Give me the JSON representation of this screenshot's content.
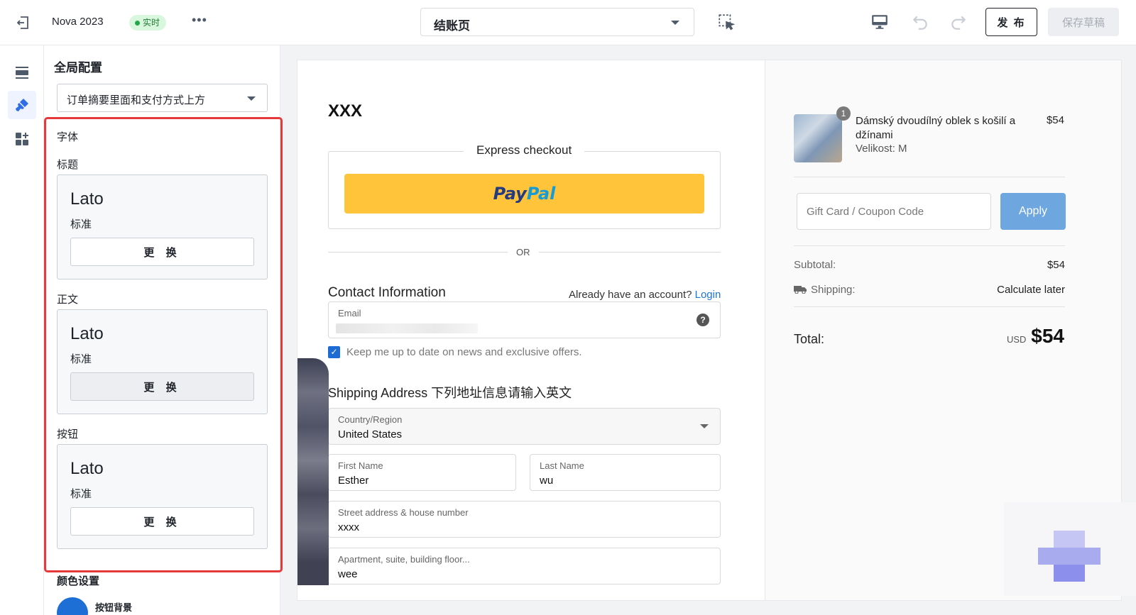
{
  "topbar": {
    "store_name": "Nova 2023",
    "live_badge": "实时",
    "more_label": "•••",
    "page_selected": "结账页",
    "publish_label": "发 布",
    "save_draft_label": "保存草稿"
  },
  "rail": {
    "items": [
      "sections-icon",
      "paint-brush-icon",
      "add-widget-icon"
    ]
  },
  "panel": {
    "title": "全局配置",
    "layout_option": "订单摘要里面和支付方式上方",
    "font_section_label": "字体",
    "fonts": [
      {
        "label": "标题",
        "family": "Lato",
        "style": "标准",
        "button": "更 换"
      },
      {
        "label": "正文",
        "family": "Lato",
        "style": "标准",
        "button": "更 换"
      },
      {
        "label": "按钮",
        "family": "Lato",
        "style": "标准",
        "button": "更 换"
      }
    ],
    "color_title": "颜色设置",
    "color_item_label": "按钮背景",
    "highlight_color": "#e5393c",
    "button_bg_color": "#1d6fd6"
  },
  "checkout": {
    "store_logo_text": "XXX",
    "express_title": "Express checkout",
    "paypal_part1": "Pay",
    "paypal_part2": "Pal",
    "or_text": "OR",
    "contact_title": "Contact Information",
    "account_question": "Already have an account?",
    "login_link": "Login",
    "email_label": "Email",
    "newsletter_label": "Keep me up to date on news and exclusive offers.",
    "shipping_title": "Shipping Address 下列地址信息请输入英文",
    "fields": {
      "country": {
        "label": "Country/Region",
        "value": "United States"
      },
      "first_name": {
        "label": "First Name",
        "value": "Esther"
      },
      "last_name": {
        "label": "Last Name",
        "value": "wu"
      },
      "street": {
        "label": "Street address & house number",
        "value": "xxxx"
      },
      "apartment": {
        "label": "Apartment, suite, building floor...",
        "value": "wee"
      }
    }
  },
  "summary": {
    "item": {
      "quantity": "1",
      "name": "Dámský dvoudílný oblek s košilí a džínami",
      "variant": "Velikost: M",
      "price": "$54"
    },
    "coupon_placeholder": "Gift Card / Coupon Code",
    "apply_label": "Apply",
    "subtotal_label": "Subtotal:",
    "subtotal_value": "$54",
    "shipping_label": "Shipping:",
    "shipping_value": "Calculate later",
    "total_label": "Total:",
    "total_currency": "USD",
    "total_value": "$54",
    "paypal_color": "#ffc439",
    "apply_color": "#6ea6e0"
  }
}
